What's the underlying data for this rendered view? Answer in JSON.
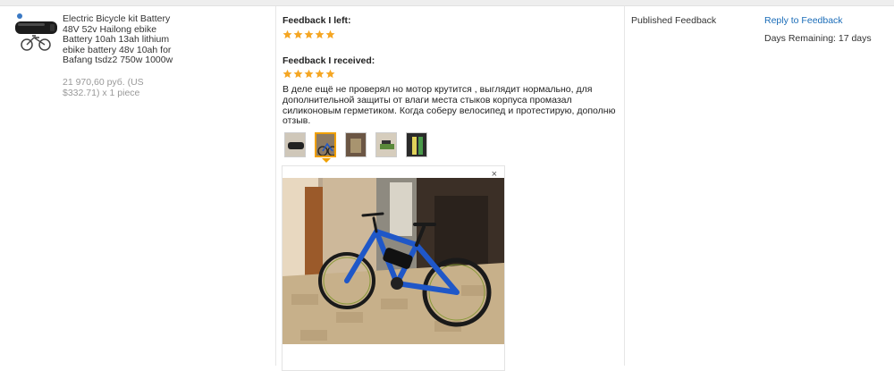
{
  "product": {
    "title": "Electric Bicycle kit Battery 48V 52v Hailong ebike Battery 10ah 13ah lithium ebike battery 48v 10ah for Bafang tsdz2 750w 1000w",
    "price": "21 970,60 руб. (US $332.71) x 1 piece",
    "image_icon": "bicycle-battery-product-icon"
  },
  "feedback_left": {
    "heading": "Feedback I left:",
    "rating": 5
  },
  "feedback_received": {
    "heading": "Feedback I received:",
    "rating": 5,
    "text": "В деле ещё не проверял но мотор крутится , выглядит нормально, для дополнительной защиты от влаги места стыков корпуса промазал силиконовым герметиком. Когда соберу велосипед и протестирую, дополню отзыв.",
    "photos_count": 5,
    "active_photo_index": 2,
    "close_label": "×"
  },
  "status": {
    "label": "Published Feedback"
  },
  "actions": {
    "reply_label": "Reply to Feedback",
    "days_remaining": "Days Remaining: 17 days"
  },
  "colors": {
    "star": "#f5a623",
    "link": "#1a6cb8",
    "active_thumb": "#f0a000",
    "bike_frame": "#1f57c8"
  }
}
